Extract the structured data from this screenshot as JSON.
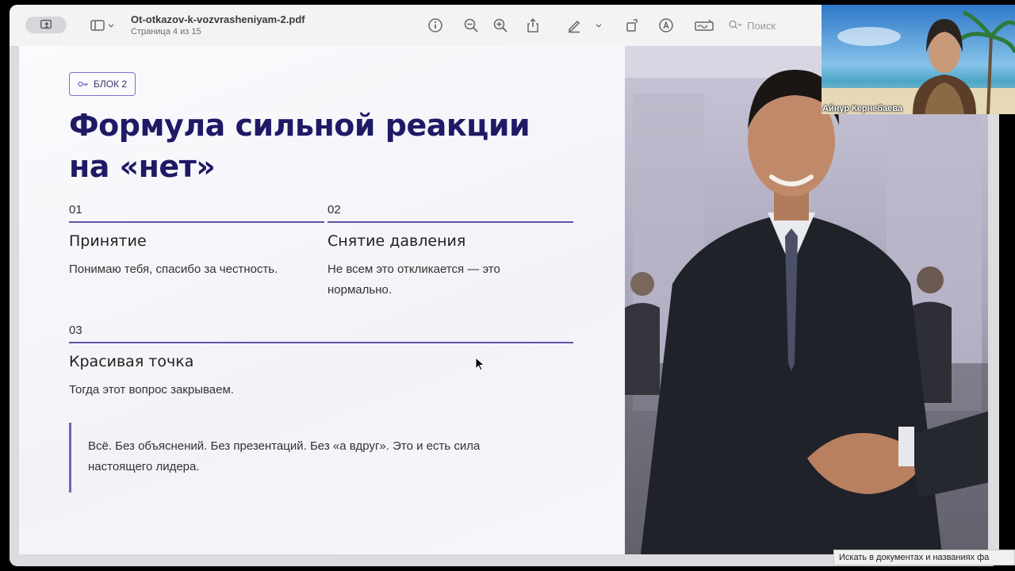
{
  "toolbar": {
    "doc_title": "Ot-otkazov-k-vozvrasheniyam-2.pdf",
    "page_info": "Страница 4 из 15",
    "search_placeholder": "Поиск"
  },
  "slide": {
    "badge": "БЛОК 2",
    "headline": "Формула сильной реакции на «нет»",
    "steps": [
      {
        "num": "01",
        "title": "Принятие",
        "text": "Понимаю тебя, спасибо за честность."
      },
      {
        "num": "02",
        "title": "Снятие давления",
        "text": "Не всем это откликается — это нормально."
      },
      {
        "num": "03",
        "title": "Красивая точка",
        "text": "Тогда этот вопрос закрываем."
      }
    ],
    "quote": "Всё. Без объяснений. Без презентаций. Без «а вдруг». Это и есть сила настоящего лидера."
  },
  "video": {
    "participant_name": "Айнур Кернебаева"
  },
  "tooltip": {
    "text": "Искать в документах и названиях фа"
  },
  "colors": {
    "accent": "#5e54a8",
    "headline": "#1f1a66",
    "badge_border": "#7c70c8"
  }
}
